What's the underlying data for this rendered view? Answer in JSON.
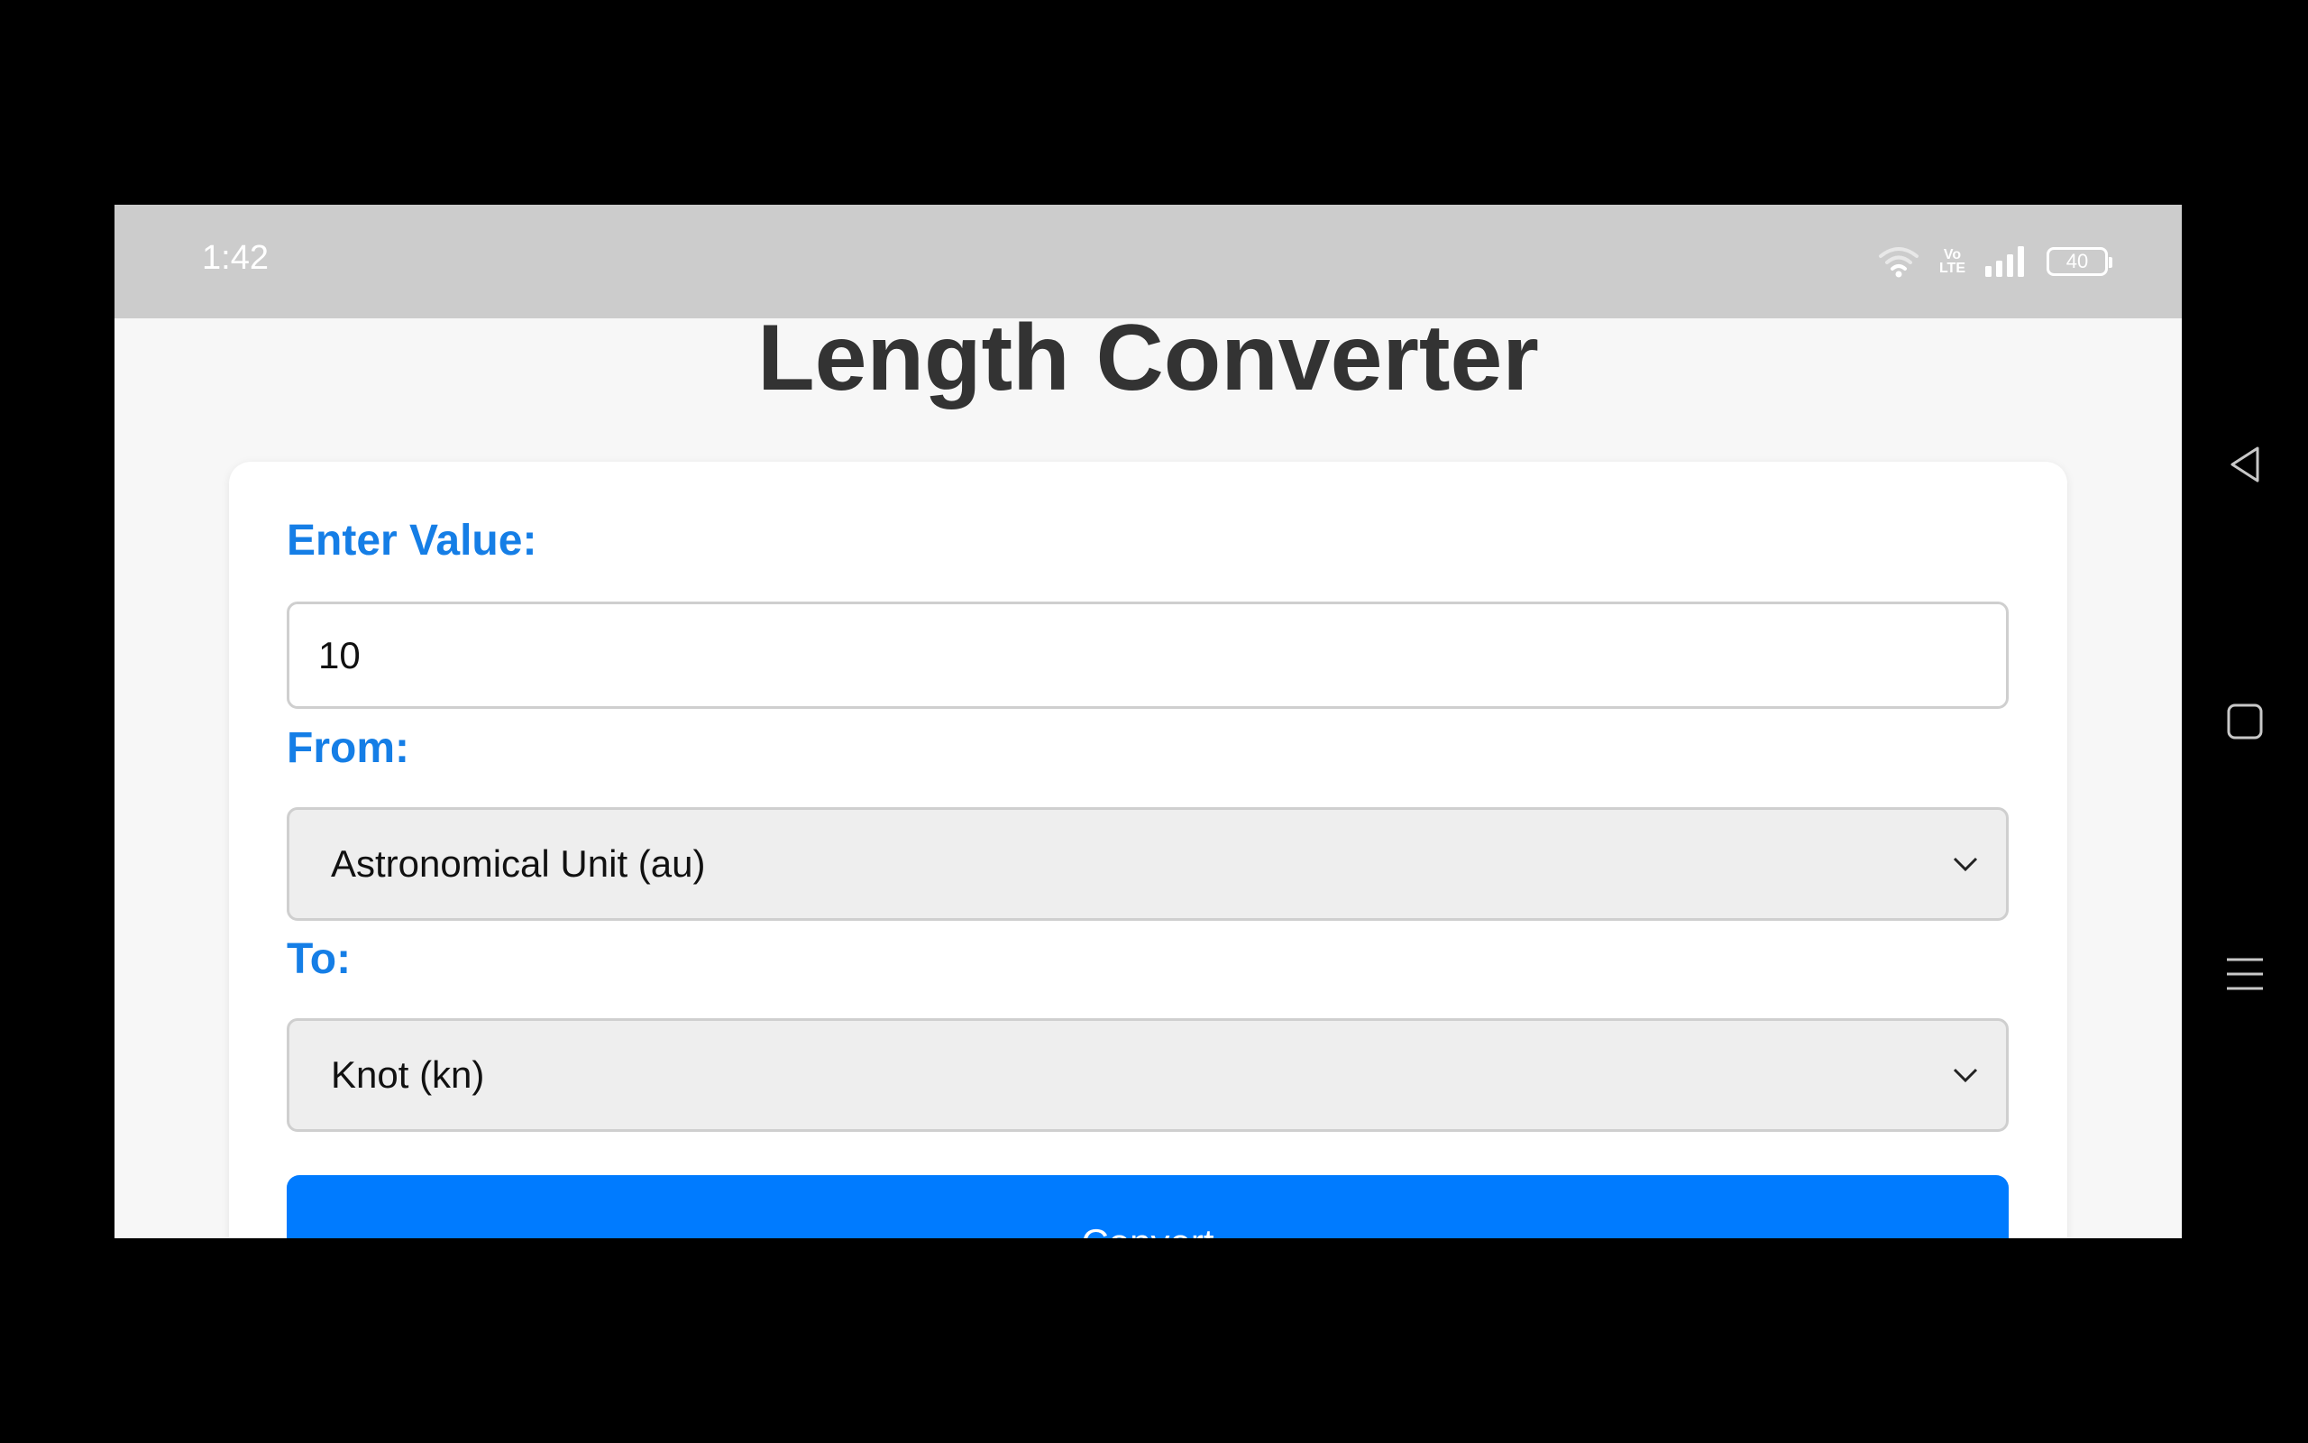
{
  "status_bar": {
    "time": "1:42",
    "network_label": "Vo\nLTE",
    "battery_level": "40",
    "icons": [
      "wifi-icon",
      "volte-icon",
      "signal-icon",
      "battery-icon"
    ]
  },
  "page": {
    "title": "Length Converter"
  },
  "form": {
    "value_label": "Enter Value:",
    "value": "10",
    "from_label": "From:",
    "from_selected": "Astronomical Unit (au)",
    "to_label": "To:",
    "to_selected": "Knot (kn)",
    "convert_label": "Convert"
  },
  "navigation": {
    "icons": [
      "back-icon",
      "home-icon",
      "recents-icon"
    ]
  },
  "colors": {
    "accent": "#007bff",
    "label": "#157ee6",
    "status_bar": "#cccccc",
    "title": "#333333"
  }
}
